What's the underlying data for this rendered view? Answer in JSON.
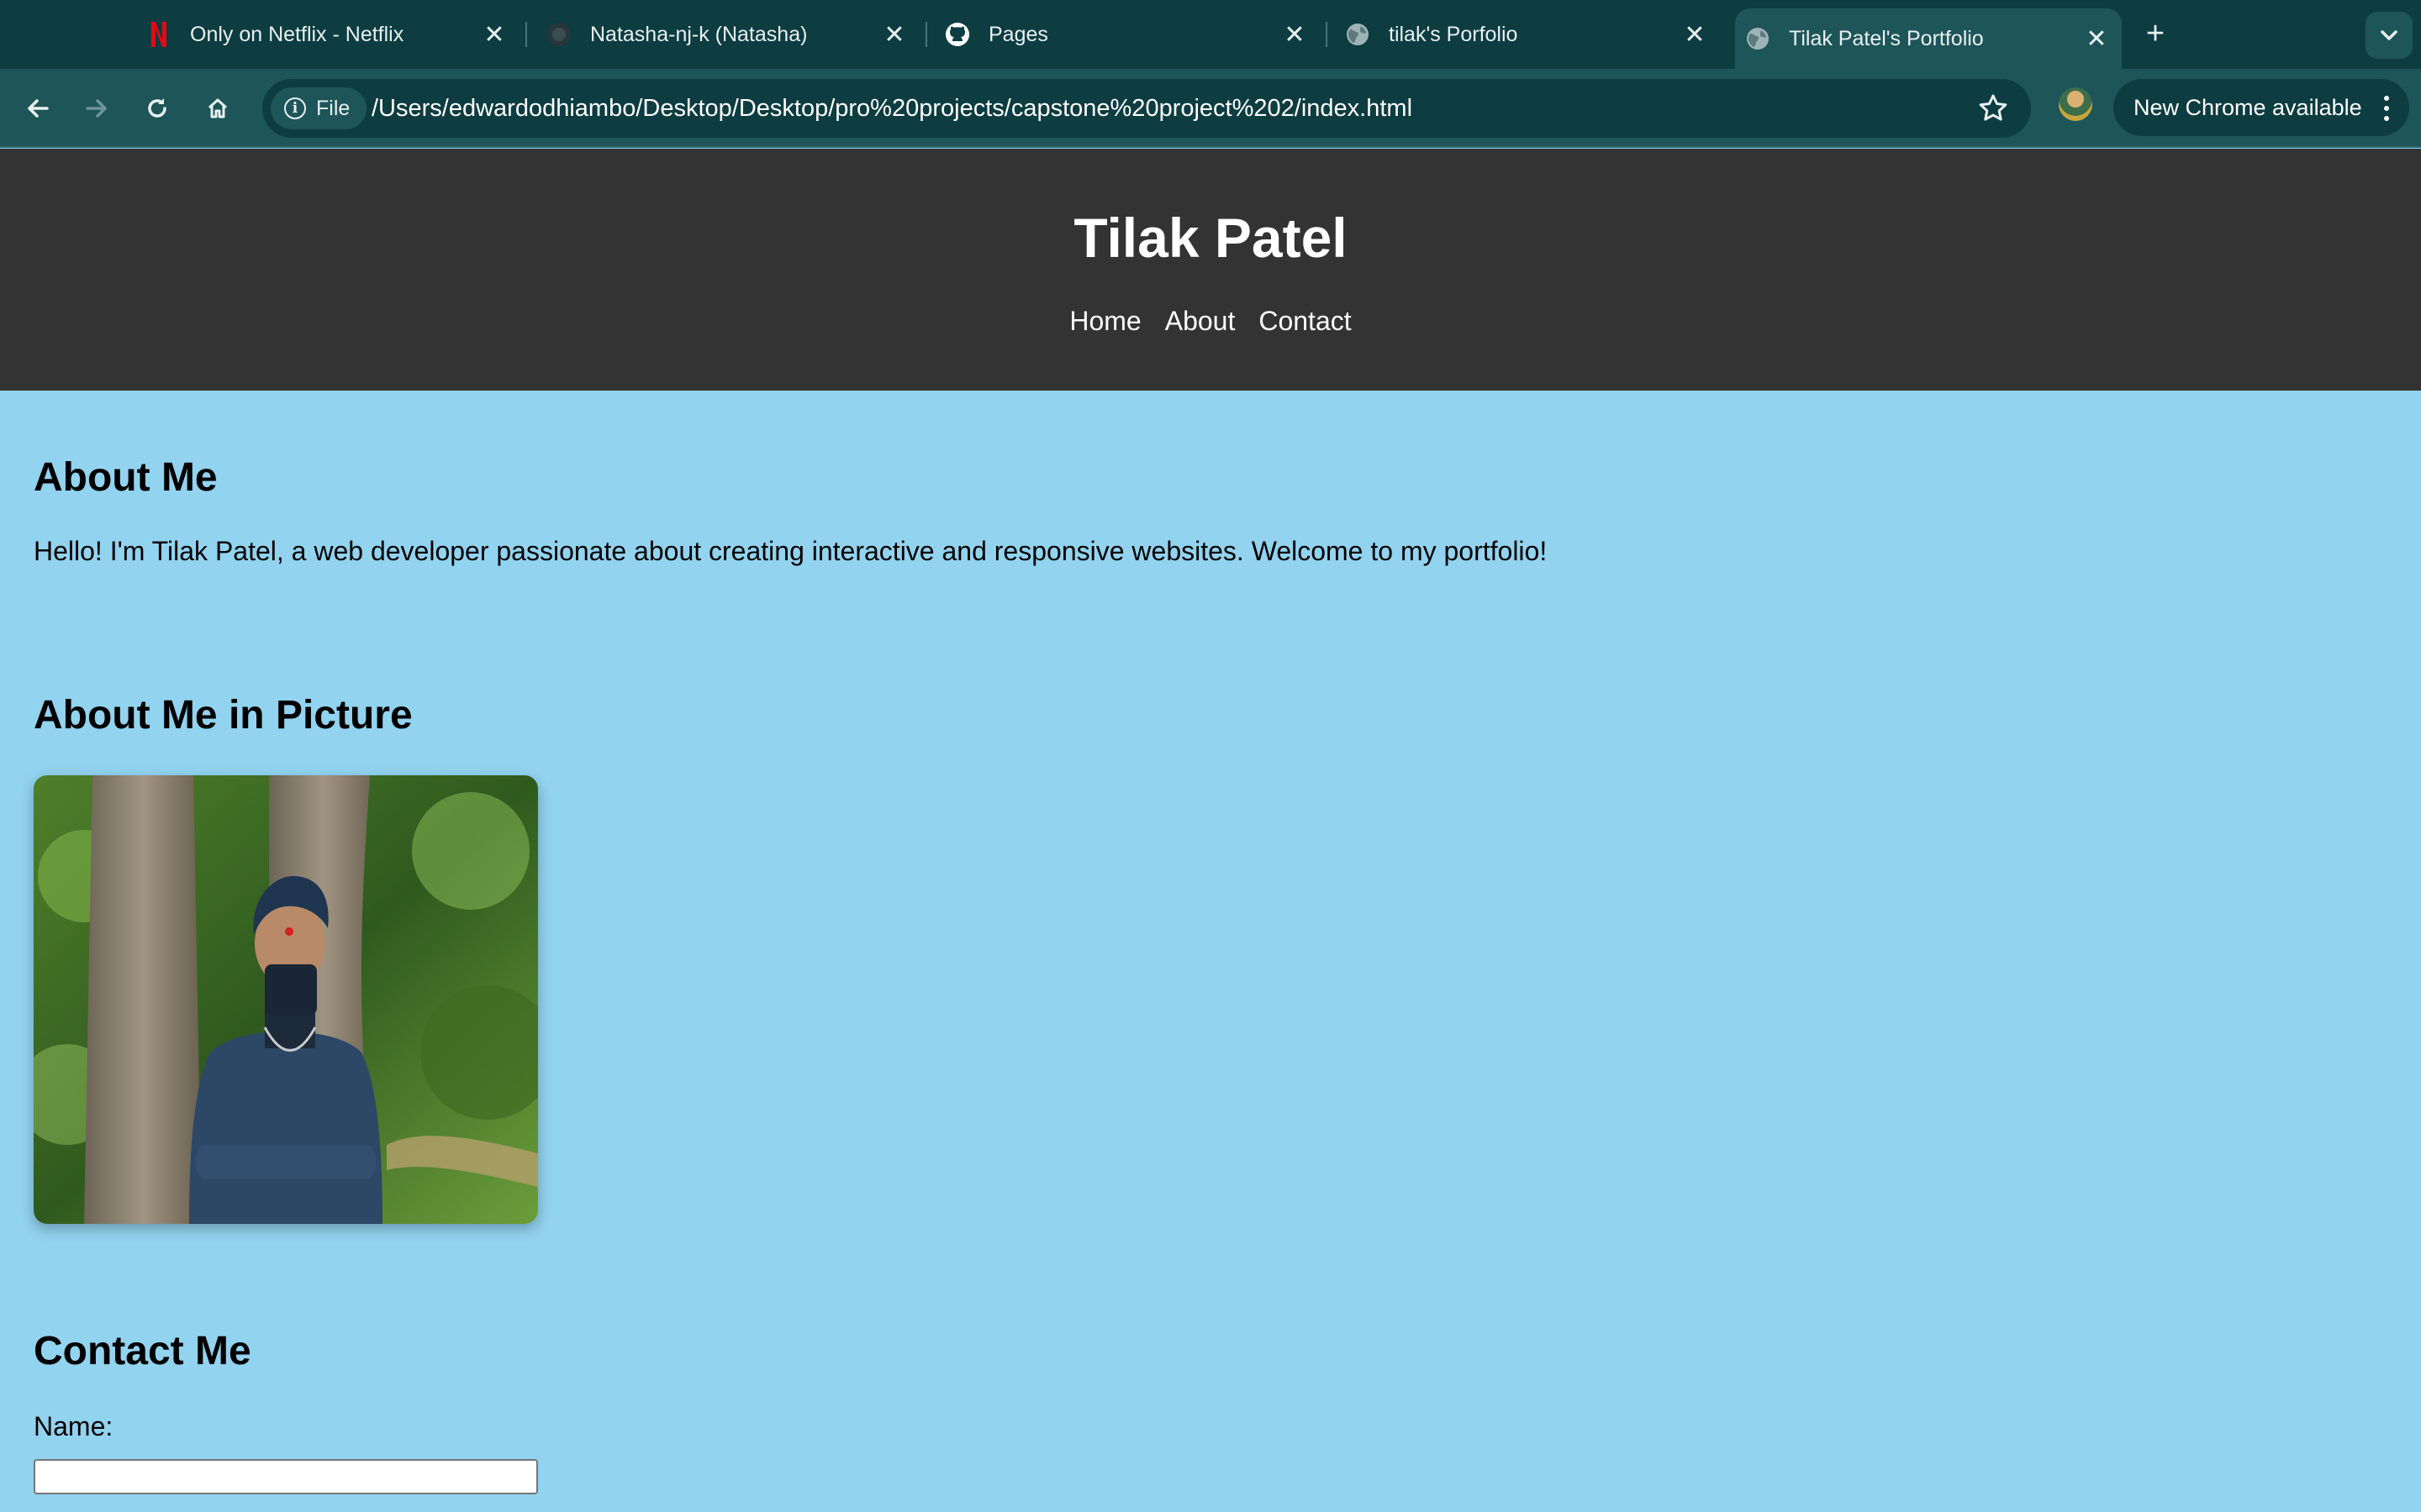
{
  "browser": {
    "tabs": [
      {
        "title": "Only on Netflix - Netflix",
        "icon": "netflix-icon"
      },
      {
        "title": "Natasha-nj-k (Natasha)",
        "icon": "github-avatar-icon"
      },
      {
        "title": "Pages",
        "icon": "github-icon"
      },
      {
        "title": "tilak's Porfolio",
        "icon": "globe-icon"
      },
      {
        "title": "Tilak Patel's Portfolio",
        "icon": "globe-icon",
        "active": true
      }
    ],
    "address": {
      "scheme_chip": "File",
      "url": "/Users/edwardodhiambo/Desktop/Desktop/pro%20projects/capstone%20project%202/index.html"
    },
    "update_button": "New Chrome available",
    "colors": {
      "tabbar": "#0d3c41",
      "toolbar": "#1e5559",
      "netflix_red": "#e50914"
    }
  },
  "page": {
    "header": {
      "title": "Tilak Patel",
      "nav": [
        "Home",
        "About",
        "Contact"
      ]
    },
    "about": {
      "heading": "About Me",
      "text": "Hello! I'm Tilak Patel, a web developer passionate about creating interactive and responsive websites. Welcome to my portfolio!"
    },
    "picture": {
      "heading": "About Me in Picture"
    },
    "contact": {
      "heading": "Contact Me",
      "name_label": "Name:",
      "name_value": ""
    },
    "colors": {
      "background": "#92d3ef",
      "header": "#333333"
    }
  }
}
